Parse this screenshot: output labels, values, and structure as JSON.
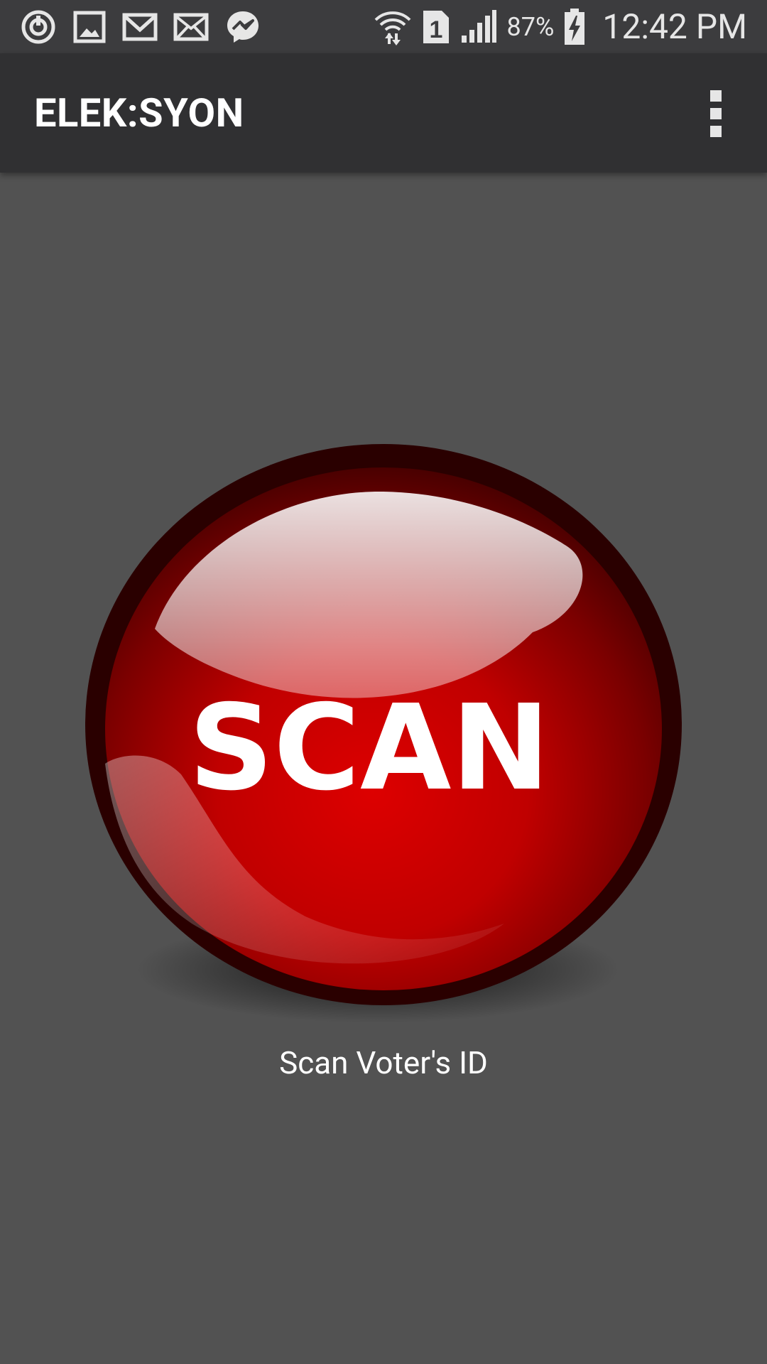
{
  "status_bar": {
    "left_icons": [
      "sync-icon",
      "gallery-icon",
      "gmail-icon",
      "mail-icon",
      "messenger-icon"
    ],
    "right_icons": [
      "wifi-icon",
      "sim-1-icon",
      "signal-icon",
      "battery-charging-icon"
    ],
    "sim_label": "1",
    "battery_percent": "87%",
    "time": "12:42 PM"
  },
  "app_bar": {
    "title": "ELEK:SYON",
    "menu_icon": "overflow-menu-icon"
  },
  "main": {
    "scan_button_label": "SCAN",
    "caption": "Scan Voter's ID"
  },
  "colors": {
    "background": "#525252",
    "app_bar": "#303032",
    "status_bar": "#3c3c3e",
    "button_red": "#cc0000"
  }
}
